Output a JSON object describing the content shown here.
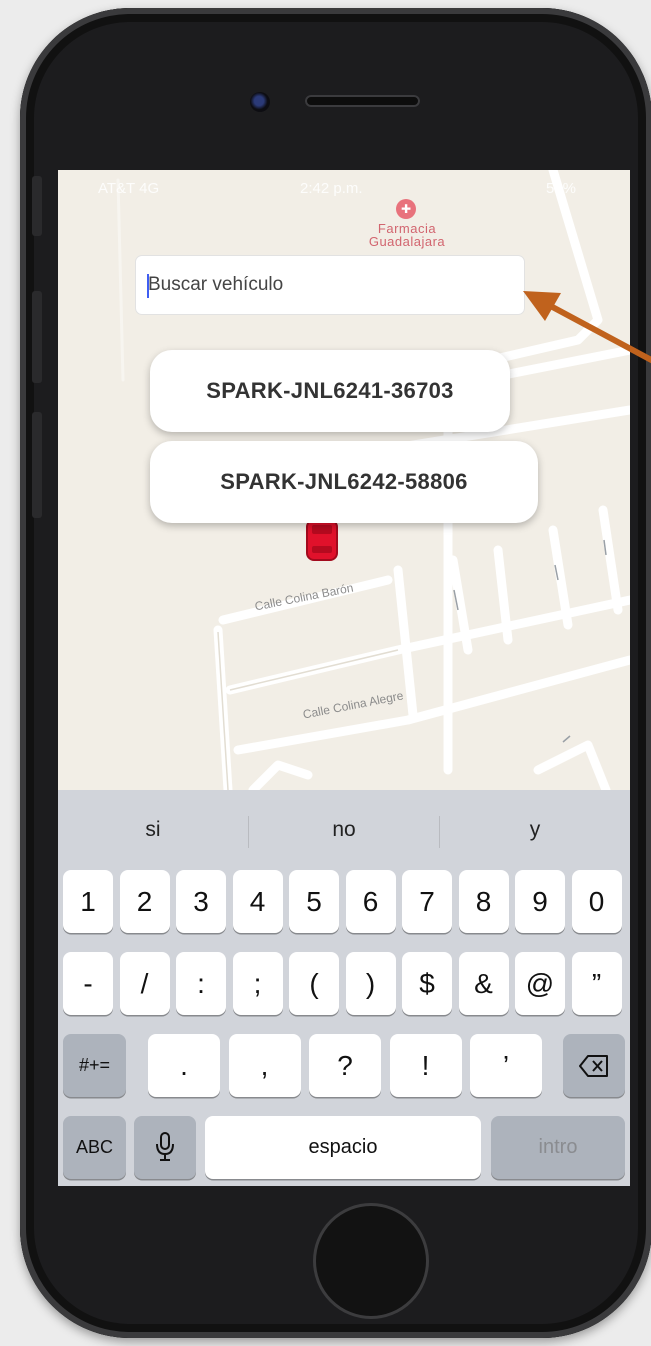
{
  "status_bar": {
    "carrier": "AT&T 4G",
    "time": "2:42 p.m.",
    "battery": "59%"
  },
  "map": {
    "poi_name": "Farmacia Guadalajara",
    "streets": [
      "Calle Colina Barón",
      "Calle Colina Alegre"
    ],
    "vehicle_marker_color": "#e0112b"
  },
  "search": {
    "placeholder": "Buscar vehículo",
    "value": ""
  },
  "results": [
    "SPARK-JNL6241-36703",
    "SPARK-JNL6242-58806"
  ],
  "annotation_arrow_color": "#c0621d",
  "keyboard": {
    "suggestions": [
      "si",
      "no",
      "y"
    ],
    "row1": [
      "1",
      "2",
      "3",
      "4",
      "5",
      "6",
      "7",
      "8",
      "9",
      "0"
    ],
    "row2": [
      "-",
      "/",
      ":",
      ";",
      "(",
      ")",
      "$",
      "&",
      "@",
      "”"
    ],
    "row3_toggle": "#+=",
    "row3": [
      ".",
      ",",
      "?",
      "!",
      "’"
    ],
    "abc": "ABC",
    "space": "espacio",
    "enter": "intro",
    "icons": [
      "microphone-icon",
      "backspace-icon"
    ]
  }
}
